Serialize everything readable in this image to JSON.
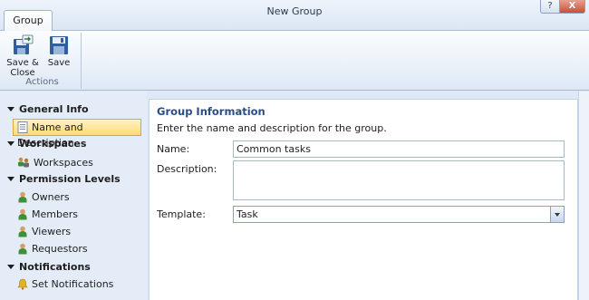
{
  "window": {
    "title": "New Group",
    "help_glyph": "?",
    "close_glyph": "X"
  },
  "ribbon": {
    "tab_label": "Group",
    "save_close_label_line1": "Save &",
    "save_close_label_line2": "Close",
    "save_label": "Save",
    "group_caption": "Actions"
  },
  "nav": {
    "sections": [
      {
        "label": "General Info",
        "items": [
          {
            "label": "Name and Description",
            "icon": "document-icon",
            "selected": true
          }
        ]
      },
      {
        "label": "Workspaces",
        "items": [
          {
            "label": "Workspaces",
            "icon": "workspaces-icon"
          }
        ]
      },
      {
        "label": "Permission Levels",
        "items": [
          {
            "label": "Owners",
            "icon": "person-icon"
          },
          {
            "label": "Members",
            "icon": "person-icon"
          },
          {
            "label": "Viewers",
            "icon": "person-icon"
          },
          {
            "label": "Requestors",
            "icon": "person-icon"
          }
        ]
      },
      {
        "label": "Notifications",
        "items": [
          {
            "label": "Set Notifications",
            "icon": "bell-icon"
          }
        ]
      }
    ]
  },
  "form": {
    "title": "Group Information",
    "instructions": "Enter the name and description for the group.",
    "name_label": "Name:",
    "name_value": "Common tasks",
    "description_label": "Description:",
    "description_value": "",
    "template_label": "Template:",
    "template_value": "Task"
  },
  "colors": {
    "accent_title": "#2a4d86",
    "selected_bg": "#ffd978",
    "close_button": "#c84f38"
  }
}
